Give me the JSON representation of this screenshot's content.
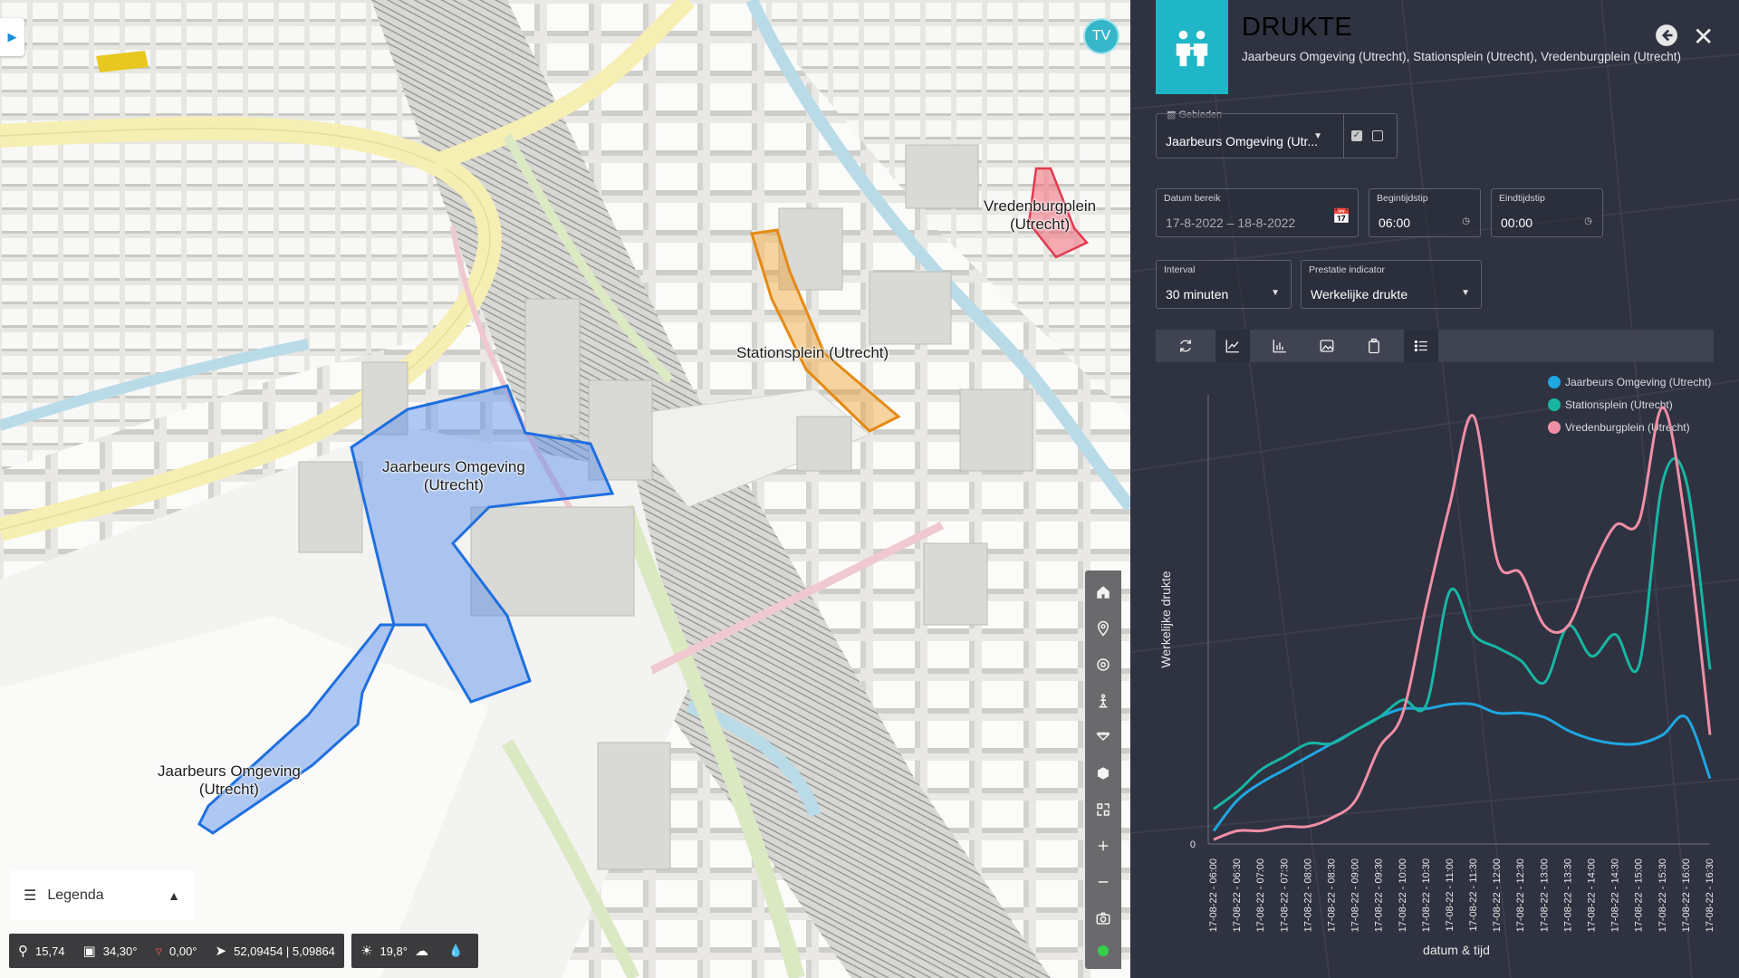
{
  "map": {
    "labels": [
      {
        "id": "jaarbeurs-1",
        "line1": "Jaarbeurs Omgeving",
        "line2": "(Utrecht)"
      },
      {
        "id": "jaarbeurs-2",
        "line1": "Jaarbeurs Omgeving",
        "line2": "(Utrecht)"
      },
      {
        "id": "stationsplein",
        "line1": "Stationsplein (Utrecht)",
        "line2": ""
      },
      {
        "id": "vredenburgplein",
        "line1": "Vredenburgplein",
        "line2": "(Utrecht)"
      }
    ],
    "area_colors": {
      "jaarbeurs": "#3b82f6",
      "stationsplein": "#f0a230",
      "vredenburgplein": "#f25c6e"
    },
    "avatar_initials": "TV",
    "toolbar_icons": [
      "home-icon",
      "location-pin-icon",
      "target-icon",
      "pedestrian-icon",
      "slice-icon",
      "cube-icon",
      "measure-icon",
      "zoom-in-icon",
      "zoom-out-icon",
      "camera-icon"
    ],
    "legend_label": "Legenda",
    "status": {
      "zoom": "15,74",
      "tilt": "34,30°",
      "heading": "0,00°",
      "coordinates": "52,09454 | 5,09864",
      "temperature": "19,8°"
    }
  },
  "panel": {
    "title": "DRUKTE",
    "subtitle": "Jaarbeurs Omgeving (Utrecht), Stationsplein (Utrecht), Vredenburgplein (Utrecht)",
    "accent": "#1fb6c8",
    "gebieden_label": "Gebieden",
    "gebieden_value": "Jaarbeurs Omgeving (Utr...",
    "datum_label": "Datum bereik",
    "datum_value": "17-8-2022 – 18-8-2022",
    "begin_label": "Begintijdstip",
    "begin_value": "06:00",
    "eind_label": "Eindtijdstip",
    "eind_value": "00:00",
    "interval_label": "Interval",
    "interval_value": "30 minuten",
    "indicator_label": "Prestatie indicator",
    "indicator_value": "Werkelijke drukte"
  },
  "chart_data": {
    "type": "line",
    "ylabel": "Werkelijke drukte",
    "xlabel": "datum & tijd",
    "y_tick_zero": "0",
    "ylim": [
      0,
      100
    ],
    "legend_position": "top-right",
    "categories": [
      "17-08-22 - 06:00",
      "17-08-22 - 06:30",
      "17-08-22 - 07:00",
      "17-08-22 - 07:30",
      "17-08-22 - 08:00",
      "17-08-22 - 08:30",
      "17-08-22 - 09:00",
      "17-08-22 - 09:30",
      "17-08-22 - 10:00",
      "17-08-22 - 10:30",
      "17-08-22 - 11:00",
      "17-08-22 - 11:30",
      "17-08-22 - 12:00",
      "17-08-22 - 12:30",
      "17-08-22 - 13:00",
      "17-08-22 - 13:30",
      "17-08-22 - 14:00",
      "17-08-22 - 14:30",
      "17-08-22 - 15:00",
      "17-08-22 - 15:30",
      "17-08-22 - 16:00",
      "17-08-22 - 16:30"
    ],
    "series": [
      {
        "name": "Jaarbeurs Omgeving (Utrecht)",
        "color": "#1ea7e0",
        "values": [
          3,
          10,
          14,
          17,
          20,
          23,
          26,
          29,
          31,
          31,
          32,
          32,
          30,
          30,
          29,
          26,
          24,
          23,
          23,
          25,
          29,
          15
        ]
      },
      {
        "name": "Stationsplein (Utrecht)",
        "color": "#17b6a3",
        "values": [
          8,
          12,
          17,
          20,
          23,
          23,
          26,
          29,
          33,
          32,
          58,
          48,
          45,
          42,
          37,
          50,
          43,
          48,
          41,
          83,
          83,
          40
        ]
      },
      {
        "name": "Vredenburgplein (Utrecht)",
        "color": "#ef8fa6",
        "values": [
          1,
          3,
          3,
          4,
          4,
          6,
          10,
          22,
          30,
          55,
          78,
          98,
          65,
          62,
          50,
          50,
          63,
          73,
          74,
          100,
          72,
          25
        ]
      }
    ]
  }
}
